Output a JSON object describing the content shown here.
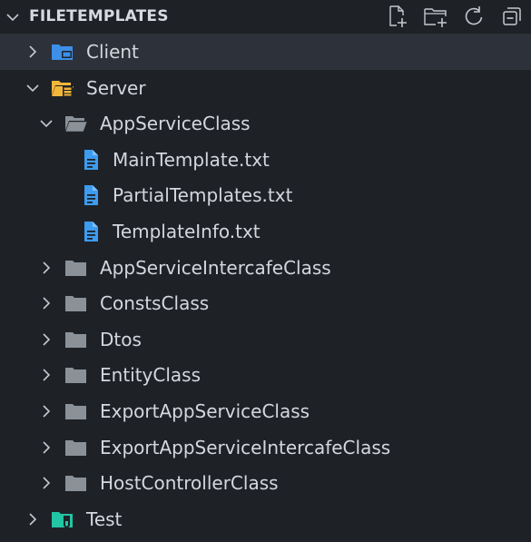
{
  "section": {
    "title": "FILETEMPLATES",
    "actions": [
      {
        "name": "new-file-button",
        "icon": "new-file-icon"
      },
      {
        "name": "new-folder-button",
        "icon": "new-folder-icon"
      },
      {
        "name": "refresh-button",
        "icon": "refresh-icon"
      },
      {
        "name": "collapse-all-button",
        "icon": "collapse-all-icon"
      }
    ]
  },
  "tree": [
    {
      "label": "Client",
      "type": "folder-special",
      "icon": "client-folder-icon",
      "expanded": false,
      "depth": 0,
      "selected": true,
      "color": "#3d8fe8"
    },
    {
      "label": "Server",
      "type": "folder-special",
      "icon": "server-folder-icon",
      "expanded": true,
      "depth": 0,
      "color": "#f2b73a"
    },
    {
      "label": "AppServiceClass",
      "type": "folder",
      "icon": "folder-open-icon",
      "expanded": true,
      "depth": 1
    },
    {
      "label": "MainTemplate.txt",
      "type": "file",
      "icon": "text-file-icon",
      "depth": 2
    },
    {
      "label": "PartialTemplates.txt",
      "type": "file",
      "icon": "text-file-icon",
      "depth": 2
    },
    {
      "label": "TemplateInfo.txt",
      "type": "file",
      "icon": "text-file-icon",
      "depth": 2
    },
    {
      "label": "AppServiceIntercafeClass",
      "type": "folder",
      "icon": "folder-icon",
      "expanded": false,
      "depth": 1
    },
    {
      "label": "ConstsClass",
      "type": "folder",
      "icon": "folder-icon",
      "expanded": false,
      "depth": 1
    },
    {
      "label": "Dtos",
      "type": "folder",
      "icon": "folder-icon",
      "expanded": false,
      "depth": 1
    },
    {
      "label": "EntityClass",
      "type": "folder",
      "icon": "folder-icon",
      "expanded": false,
      "depth": 1
    },
    {
      "label": "ExportAppServiceClass",
      "type": "folder",
      "icon": "folder-icon",
      "expanded": false,
      "depth": 1
    },
    {
      "label": "ExportAppServiceIntercafeClass",
      "type": "folder",
      "icon": "folder-icon",
      "expanded": false,
      "depth": 1
    },
    {
      "label": "HostControllerClass",
      "type": "folder",
      "icon": "folder-icon",
      "expanded": false,
      "depth": 1
    },
    {
      "label": "Test",
      "type": "folder-special",
      "icon": "test-folder-icon",
      "expanded": false,
      "depth": 0,
      "color": "#22c5a4"
    }
  ],
  "colors": {
    "background": "#1e2227",
    "selection": "#2c313a",
    "text": "#d4d7dd",
    "folder": "#8a9199",
    "file_icon": "#3d9bf0"
  }
}
